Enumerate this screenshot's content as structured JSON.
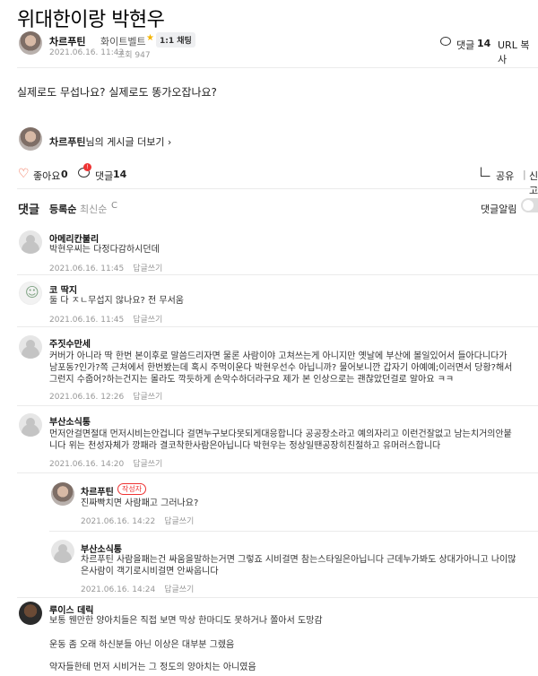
{
  "post": {
    "title": "위대한이랑 박현우",
    "author": "차르푸틴",
    "level": "화이트벨트",
    "chat_badge": "1:1 채팅",
    "date": "2021.06.16. 11:43",
    "views": "조회 947",
    "comment_label": "댓글",
    "comment_count": "14",
    "url_copy": "URL 복사",
    "body": "실제로도 무섭나요? 실제로도 똥가오잡나요?",
    "more_author": "차르푸틴",
    "more_suffix": "님의 게시글 더보기 ›"
  },
  "actions": {
    "like_label": "좋아요",
    "like_count": "0",
    "comment_label": "댓글",
    "comment_count": "14",
    "comment_badge": "!",
    "share_label": "공유",
    "report_label": "신고"
  },
  "comments_header": {
    "title": "댓글",
    "sort_registered": "등록순",
    "sort_latest": "최신순",
    "refresh_icon": "C",
    "alarm_label": "댓글알림"
  },
  "comments": [
    {
      "name": "아메리칸불리",
      "text": "박현우씨는 다정다감하시던데",
      "date": "2021.06.16. 11:45",
      "reply": "답글쓰기"
    },
    {
      "name": "코 딱지",
      "text": "둘 다 ㅈㄴ무섭지 않나요? 전 무서움",
      "date": "2021.06.16. 11:45",
      "reply": "답글쓰기"
    },
    {
      "name": "주짓수만세",
      "text1": "커버가 아니라 딱 한번 본이후로 말씀드리자면 물론 사람이야 고쳐쓰는게 아니지만 옛날에 부산에 볼일있어서 들아다니다가",
      "text2": "남포동?인가?쪽 근처에서 한번봤는데 혹시 주먹이운다 박현우선수 아닙니까? 물어보니깐 갑자기 아예예;이러면서 당황?해서",
      "text3": "그런지 수줍어?하는건지는 몰라도 깍듯하게 손악수하더라구요 제가 본 인상으로는 괜찮았던걸로 알아요 ㅋㅋ",
      "date": "2021.06.16. 12:26",
      "reply": "답글쓰기"
    },
    {
      "name": "부산소식통",
      "text1": "먼저안걸면절대 먼저시비는안겁니다 걸면누구보다못되게대응합니다 공공장소라고 예의자리고 이런건잘없고 남는치거의안붙",
      "text2": "니다 위는 천성자체가 깡패라 결코착한사람은아닙니다 박현우는 정상일땐공장히친절하고 유머러스합니다",
      "date": "2021.06.16. 14:20",
      "reply": "답글쓰기"
    },
    {
      "name": "차르푸틴",
      "tag": "작성자",
      "text": "진짜빡치면 사람패고 그러나요?",
      "date": "2021.06.16. 14:22",
      "reply": "답글쓰기"
    },
    {
      "name": "부산소식통",
      "text1": "차르푸틴 사람을패는건 싸움을말하는거면 그렇죠 시비걸면 참는스타일은아닙니다 근데누가봐도 상대가아니고 나이많",
      "text2": "은사람이 객기로시비걸면 안싸웁니다",
      "date": "2021.06.16. 14:24",
      "reply": "답글쓰기"
    },
    {
      "name": "루이스 데릭",
      "text1": "보통 웬만한 양아치들은 직접 보면 막상 한마디도 못하거나 쫄아서 도망감",
      "text2": "운동 좀 오래 하신분들 아닌 이상은 대부분 그렜음",
      "text3": "약자들한테 먼저 시비거는 그 정도의 양아치는 아니였음"
    }
  ],
  "colors": {
    "accent": "#e53333",
    "meta": "#979797",
    "divider": "#ebebeb"
  }
}
